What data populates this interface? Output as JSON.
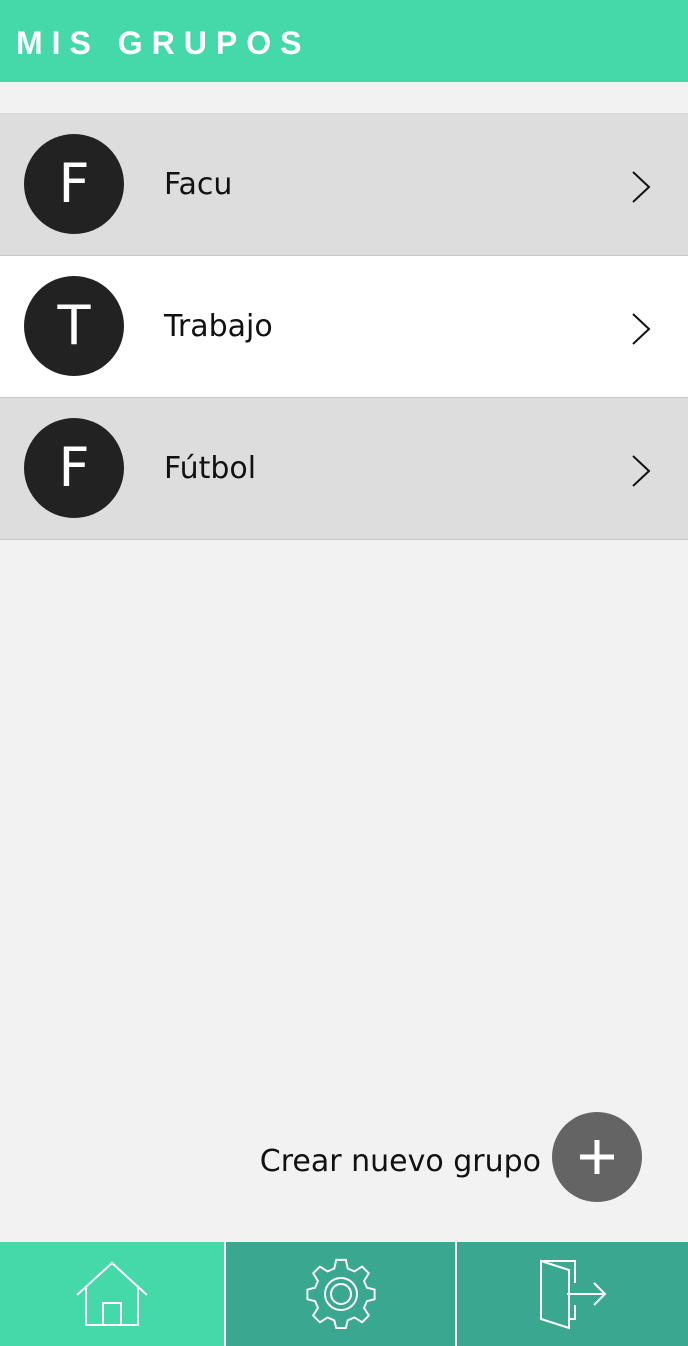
{
  "header": {
    "title": "MIS GRUPOS"
  },
  "groups": [
    {
      "initial": "F",
      "name": "Facu"
    },
    {
      "initial": "T",
      "name": "Trabajo"
    },
    {
      "initial": "F",
      "name": "Fútbol"
    }
  ],
  "create_group": {
    "label": "Crear nuevo grupo",
    "icon": "plus-icon"
  },
  "bottom_nav": {
    "items": [
      {
        "icon": "home-icon",
        "active": true
      },
      {
        "icon": "gear-icon",
        "active": false
      },
      {
        "icon": "logout-icon",
        "active": false
      }
    ]
  },
  "colors": {
    "accent": "#45d9aa",
    "nav_inactive": "#3aa891",
    "avatar": "#222222",
    "fab": "#646464",
    "row_shaded": "#dddddd",
    "row_plain": "#ffffff",
    "background": "#f2f2f2"
  }
}
